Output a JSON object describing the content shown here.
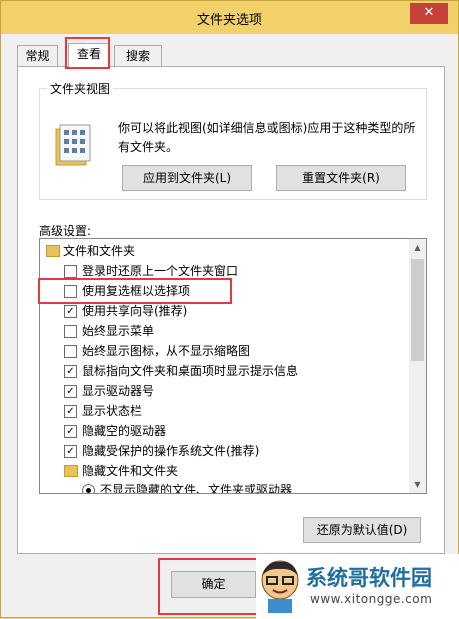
{
  "window": {
    "title": "文件夹选项",
    "close_symbol": "✕"
  },
  "tabs": [
    {
      "label": "常规",
      "active": false
    },
    {
      "label": "查看",
      "active": true
    },
    {
      "label": "搜索",
      "active": false
    }
  ],
  "folder_views": {
    "title": "文件夹视图",
    "description": "你可以将此视图(如详细信息或图标)应用于这种类型的所有文件夹。",
    "apply_button": "应用到文件夹(L)",
    "reset_button": "重置文件夹(R)"
  },
  "advanced": {
    "label": "高级设置:",
    "items": [
      {
        "type": "folder",
        "label": "文件和文件夹"
      },
      {
        "type": "checkbox",
        "checked": false,
        "label": "登录时还原上一个文件夹窗口"
      },
      {
        "type": "checkbox",
        "checked": false,
        "label": "使用复选框以选择项"
      },
      {
        "type": "checkbox",
        "checked": true,
        "label": "使用共享向导(推荐)"
      },
      {
        "type": "checkbox",
        "checked": false,
        "label": "始终显示菜单"
      },
      {
        "type": "checkbox",
        "checked": false,
        "label": "始终显示图标，从不显示缩略图"
      },
      {
        "type": "checkbox",
        "checked": true,
        "label": "鼠标指向文件夹和桌面项时显示提示信息"
      },
      {
        "type": "checkbox",
        "checked": true,
        "label": "显示驱动器号"
      },
      {
        "type": "checkbox",
        "checked": true,
        "label": "显示状态栏"
      },
      {
        "type": "checkbox",
        "checked": true,
        "label": "隐藏空的驱动器"
      },
      {
        "type": "checkbox",
        "checked": true,
        "label": "隐藏受保护的操作系统文件(推荐)"
      },
      {
        "type": "folder",
        "label": "隐藏文件和文件夹"
      },
      {
        "type": "radio",
        "checked": true,
        "label": "不显示隐藏的文件、文件夹或驱动器"
      }
    ],
    "restore_button": "还原为默认值(D)"
  },
  "footer": {
    "ok_button": "确定"
  },
  "watermark": {
    "name": "系统哥软件园",
    "url": "www.xitongge.com"
  }
}
